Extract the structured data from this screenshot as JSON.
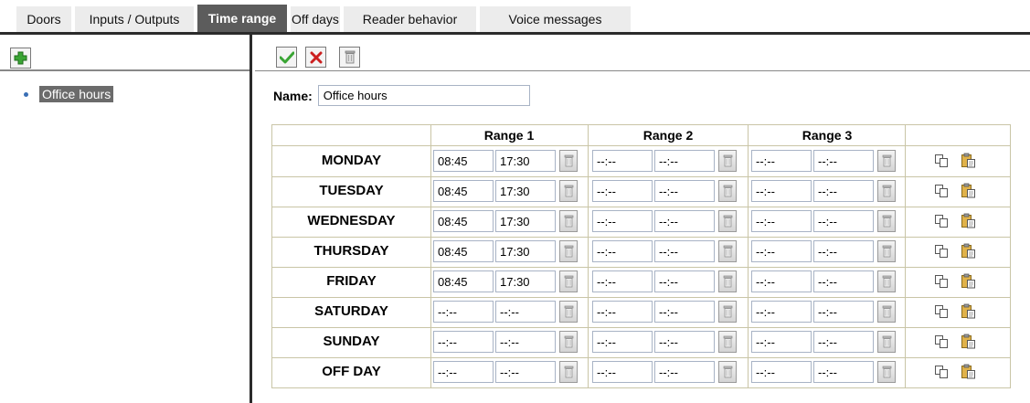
{
  "tabs": [
    {
      "label": "Doors",
      "active": false
    },
    {
      "label": "Inputs / Outputs",
      "active": false
    },
    {
      "label": "Time range",
      "active": true
    },
    {
      "label": "Off days",
      "active": false
    },
    {
      "label": "Reader behavior",
      "active": false
    },
    {
      "label": "Voice messages",
      "active": false
    }
  ],
  "sidebar": {
    "add_icon": "plus-icon",
    "items": [
      {
        "label": "Office hours",
        "selected": true
      }
    ]
  },
  "toolbar": {
    "save_icon": "checkmark-icon",
    "cancel_icon": "x-icon",
    "delete_icon": "trash-icon"
  },
  "form": {
    "name_label": "Name:",
    "name_value": "Office hours"
  },
  "schedule": {
    "headers": [
      "Range 1",
      "Range 2",
      "Range 3"
    ],
    "empty_time": "--:--",
    "rows": [
      {
        "day": "MONDAY",
        "ranges": [
          [
            "08:45",
            "17:30"
          ],
          [
            "--:--",
            "--:--"
          ],
          [
            "--:--",
            "--:--"
          ]
        ]
      },
      {
        "day": "TUESDAY",
        "ranges": [
          [
            "08:45",
            "17:30"
          ],
          [
            "--:--",
            "--:--"
          ],
          [
            "--:--",
            "--:--"
          ]
        ]
      },
      {
        "day": "WEDNESDAY",
        "ranges": [
          [
            "08:45",
            "17:30"
          ],
          [
            "--:--",
            "--:--"
          ],
          [
            "--:--",
            "--:--"
          ]
        ]
      },
      {
        "day": "THURSDAY",
        "ranges": [
          [
            "08:45",
            "17:30"
          ],
          [
            "--:--",
            "--:--"
          ],
          [
            "--:--",
            "--:--"
          ]
        ]
      },
      {
        "day": "FRIDAY",
        "ranges": [
          [
            "08:45",
            "17:30"
          ],
          [
            "--:--",
            "--:--"
          ],
          [
            "--:--",
            "--:--"
          ]
        ]
      },
      {
        "day": "SATURDAY",
        "ranges": [
          [
            "--:--",
            "--:--"
          ],
          [
            "--:--",
            "--:--"
          ],
          [
            "--:--",
            "--:--"
          ]
        ]
      },
      {
        "day": "SUNDAY",
        "ranges": [
          [
            "--:--",
            "--:--"
          ],
          [
            "--:--",
            "--:--"
          ],
          [
            "--:--",
            "--:--"
          ]
        ]
      },
      {
        "day": "OFF DAY",
        "ranges": [
          [
            "--:--",
            "--:--"
          ],
          [
            "--:--",
            "--:--"
          ],
          [
            "--:--",
            "--:--"
          ]
        ]
      }
    ],
    "row_icons": [
      "copy-icon",
      "paste-icon"
    ]
  },
  "colors": {
    "active_tab": "#5c5c5c",
    "selected_item": "#6b6b6b",
    "table_border": "#c9c5a6",
    "input_border": "#a8b3c5",
    "save_green": "#3aa534",
    "cancel_red": "#cc1f1f"
  }
}
